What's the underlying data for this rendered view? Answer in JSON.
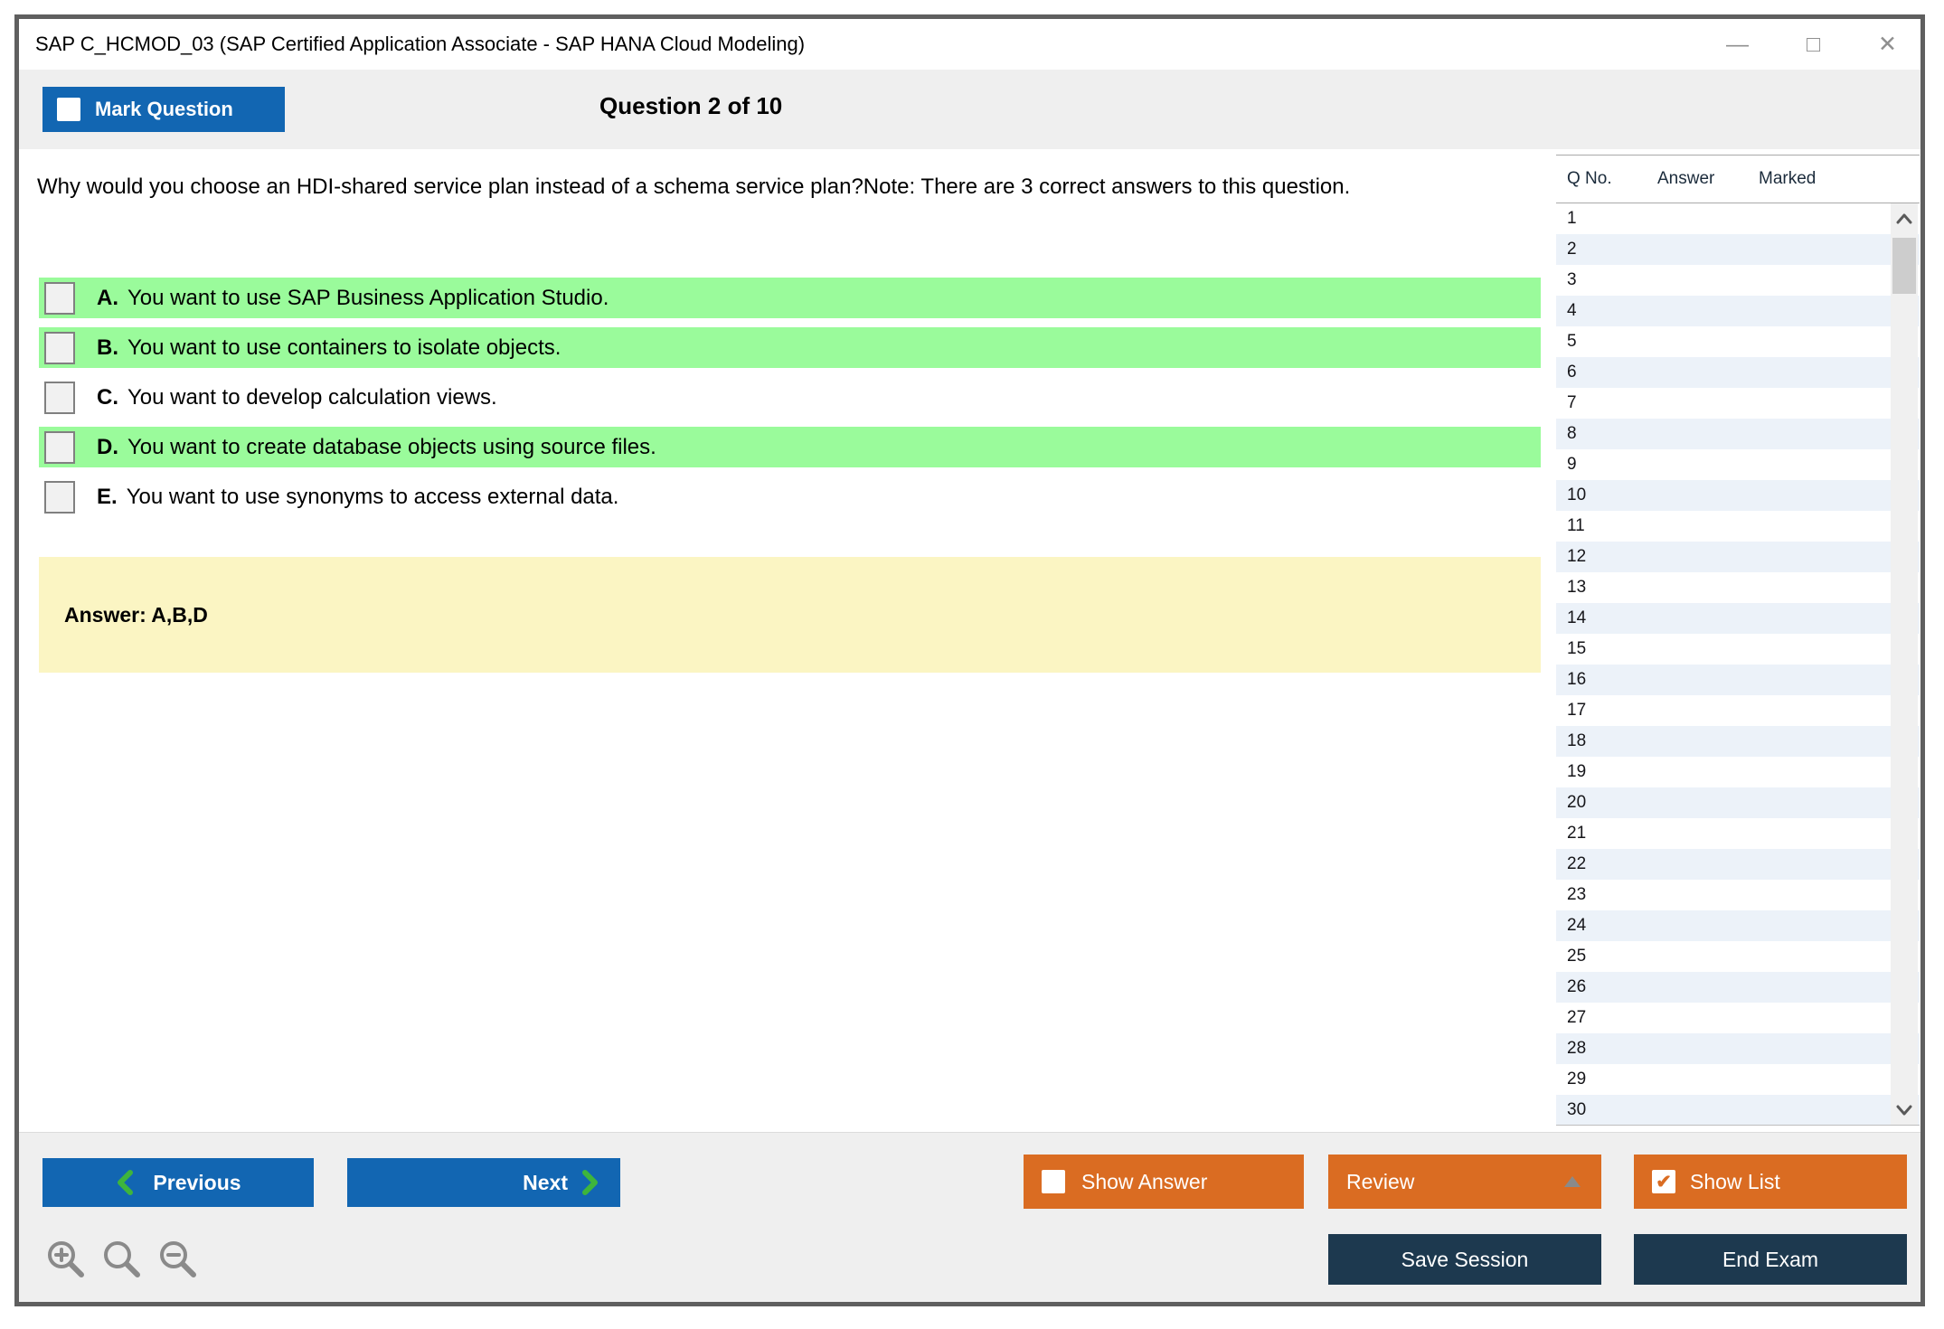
{
  "window": {
    "title": "SAP C_HCMOD_03 (SAP Certified Application Associate - SAP HANA Cloud Modeling)"
  },
  "icons": {
    "minimize": "—",
    "maximize": "□",
    "close": "✕",
    "checkmark": "✔"
  },
  "header": {
    "mark_question": "Mark Question",
    "question_counter": "Question 2 of 10"
  },
  "question": {
    "text": "Why would you choose an HDI-shared service plan instead of a schema service plan?Note: There are 3 correct answers to this question.",
    "options": [
      {
        "letter": "A.",
        "text": "You want to use SAP Business Application Studio.",
        "highlighted": true
      },
      {
        "letter": "B.",
        "text": "You want to use containers to isolate objects.",
        "highlighted": true
      },
      {
        "letter": "C.",
        "text": "You want to develop calculation views.",
        "highlighted": false
      },
      {
        "letter": "D.",
        "text": "You want to create database objects using source files.",
        "highlighted": true
      },
      {
        "letter": "E.",
        "text": "You want to use synonyms to access external data.",
        "highlighted": false
      }
    ],
    "answer": "Answer: A,B,D"
  },
  "question_list": {
    "columns": [
      "Q No.",
      "Answer",
      "Marked"
    ],
    "numbers": [
      "1",
      "2",
      "3",
      "4",
      "5",
      "6",
      "7",
      "8",
      "9",
      "10",
      "11",
      "12",
      "13",
      "14",
      "15",
      "16",
      "17",
      "18",
      "19",
      "20",
      "21",
      "22",
      "23",
      "24",
      "25",
      "26",
      "27",
      "28",
      "29",
      "30"
    ]
  },
  "footer": {
    "previous": "Previous",
    "next": "Next",
    "show_answer": "Show Answer",
    "review": "Review",
    "show_list": "Show List",
    "save_session": "Save Session",
    "end_exam": "End Exam"
  },
  "colors": {
    "primary_blue": "#1266b2",
    "accent_orange": "#da6c22",
    "dark_navy": "#1d394f",
    "chevron_green": "#3eb53c",
    "option_highlight_green": "#9afb9b",
    "answer_box_yellow": "#fbf5c3"
  }
}
